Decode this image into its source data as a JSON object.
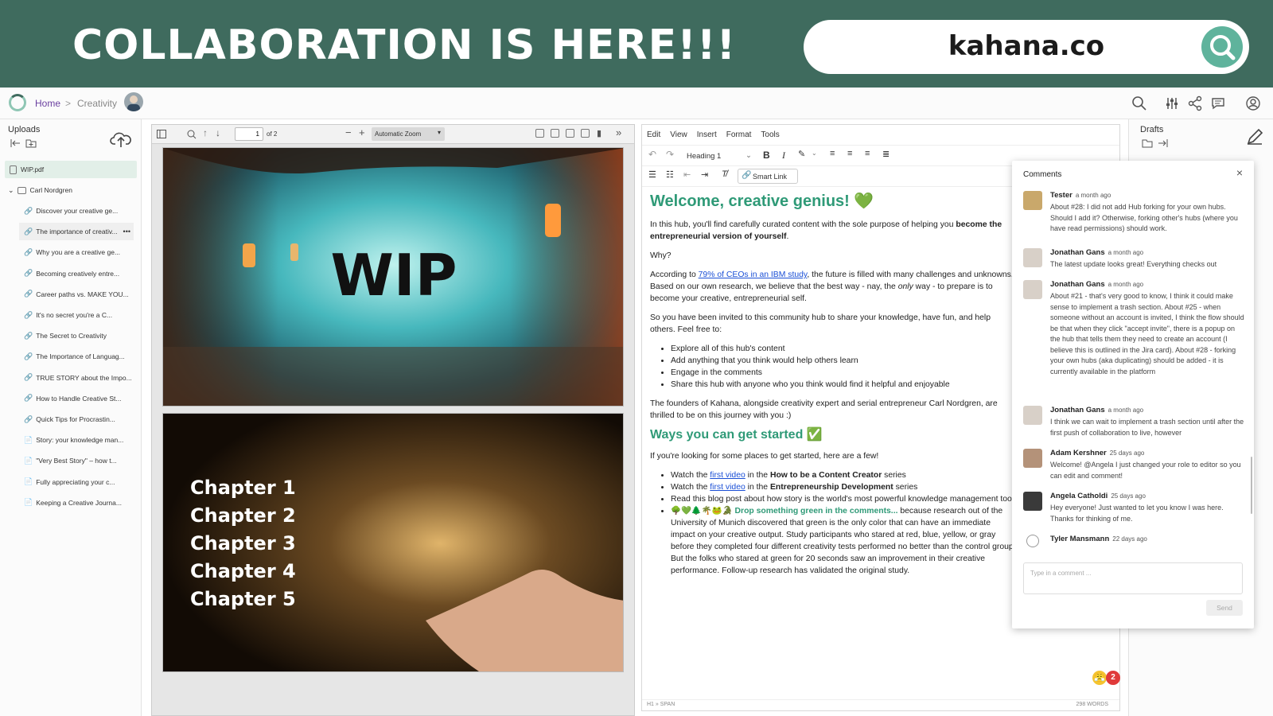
{
  "banner": {
    "title": "COLLABORATION IS HERE!!!",
    "url": "kahana.co",
    "search_icon": "search-icon"
  },
  "appbar": {
    "home": "Home",
    "separator": ">",
    "current": "Creativity",
    "icons": [
      "search-icon",
      "sliders-icon",
      "share-icon",
      "chat-icon",
      "user-icon"
    ]
  },
  "uploads": {
    "title": "Uploads",
    "file": "WIP.pdf",
    "folder": "Carl Nordgren",
    "items": [
      "Discover your creative ge...",
      "The importance of creativ...",
      "Why you are a creative ge...",
      "Becoming creatively entre...",
      "Career paths vs. MAKE YOU...",
      "It's no secret you're a C...",
      "The Secret to Creativity",
      "The Importance of Languag...",
      "TRUE STORY about the Impo...",
      "How to Handle Creative St...",
      "Quick Tips for Procrastin...",
      "Story: your knowledge man...",
      "\"Very Best Story\" – how t...",
      "Fully appreciating your c...",
      "Keeping a Creative Journa..."
    ],
    "more": "•••"
  },
  "pdf": {
    "page_value": "1",
    "page_total": "of 2",
    "zoom": "Automatic Zoom",
    "page1_text": "WIP",
    "chapters": [
      "Chapter 1",
      "Chapter 2",
      "Chapter 3",
      "Chapter 4",
      "Chapter 5"
    ]
  },
  "editor": {
    "menu": [
      "Edit",
      "View",
      "Insert",
      "Format",
      "Tools"
    ],
    "block_format": "Heading 1",
    "smart_link": "Smart Link",
    "h1": "Welcome, creative genius! 💚",
    "p1_a": "In this hub, you'll find carefully curated content with the sole purpose of helping you ",
    "p1_b": "become the entrepreneurial version of yourself",
    "p1_c": ".",
    "p2": "Why?",
    "p3_a": "According to ",
    "p3_link": "79% of CEOs in an IBM study",
    "p3_b": ", the future is filled with many challenges and unknowns. Based on our own research, we believe that the best way - nay, the ",
    "p3_em": "only",
    "p3_c": " way - to prepare is to become your creative, entrepreneurial self.",
    "p4": "So you have been invited to this community hub to share your knowledge, have fun, and help others. Feel free to:",
    "list1": [
      "Explore all of this hub's content",
      "Add anything that you think would help others learn",
      "Engage in the comments",
      "Share this hub with anyone who you think would find it helpful and enjoyable"
    ],
    "p5": "The founders of Kahana, alongside creativity expert and serial entrepreneur Carl Nordgren, are thrilled to be on this journey with you :)",
    "h2": "Ways you can get started ✅",
    "p6": "If you're looking for some places to get started, here are a few!",
    "l2_1a": "Watch the ",
    "l2_1link": "first video",
    "l2_1b": " in the ",
    "l2_1c": "How to be a Content Creator",
    "l2_1d": " series",
    "l2_2a": "Watch the ",
    "l2_2link": "first video",
    "l2_2b": " in the ",
    "l2_2c": "Entrepreneurship Development",
    "l2_2d": " series",
    "l2_3": "Read this blog post about how story is the world's most powerful knowledge management tool",
    "l2_4a": "🌳💚🌲🌴🐸🐊 ",
    "l2_4b": "Drop something green in the comments...",
    "l2_4c": " because research out of the University of Munich discovered that green is the only color that can have an immediate impact on your creative output. Study participants who stared at red, blue, yellow, or gray before they completed four different creativity tests performed no better than the control group. But the folks who stared at green for 20 seconds saw an improvement in their creative performance. Follow-up research has validated the original study.",
    "status_path": "H1 » SPAN",
    "word_count": "298 WORDS",
    "badge_count": "2"
  },
  "drafts": {
    "title": "Drafts"
  },
  "comments": {
    "title": "Comments",
    "close": "×",
    "items": [
      {
        "name": "Tester",
        "time": "a month ago",
        "text": "About #28: I did not add Hub forking for your own hubs. Should I add it? Otherwise, forking other's hubs (where you have read permissions) should work."
      },
      {
        "name": "Jonathan Gans",
        "time": "a month ago",
        "text": "The latest update looks great! Everything checks out"
      },
      {
        "name": "Jonathan Gans",
        "time": "a month ago",
        "text": "About #21 - that's very good to know, I think it could make sense to implement a trash section. About #25 - when someone without an account is invited, I think the flow should be that when they click \"accept invite\", there is a popup on the hub that tells them they need to create an account (I believe this is outlined in the Jira card). About #28 - forking your own hubs (aka duplicating) should be added - it is currently available in the platform"
      },
      {
        "name": "Jonathan Gans",
        "time": "a month ago",
        "text": "I think we can wait to implement a trash section until after the first push of collaboration to live, however"
      },
      {
        "name": "Adam Kershner",
        "time": "25 days ago",
        "text": "Welcome! @Angela I just changed your role to editor so you can edit and comment!"
      },
      {
        "name": "Angela Catholdi",
        "time": "25 days ago",
        "text": "Hey everyone! Just wanted to let you know I was here. Thanks for thinking of me."
      },
      {
        "name": "Tyler Mansmann",
        "time": "22 days ago",
        "text": ""
      }
    ],
    "placeholder": "Type in a comment ...",
    "send": "Send"
  }
}
